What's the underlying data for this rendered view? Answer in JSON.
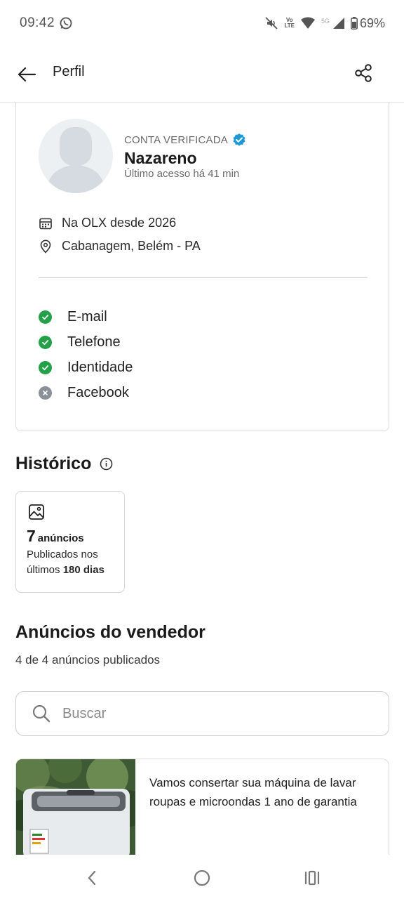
{
  "status_bar": {
    "time": "09:42",
    "battery": "69%",
    "network_badge": "5G",
    "volte_top": "Vo",
    "volte_bottom": "LTE"
  },
  "app_bar": {
    "title": "Perfil"
  },
  "profile": {
    "verified_label": "CONTA VERIFICADA",
    "name": "Nazareno",
    "last_access": "Último acesso há 41 min",
    "member_since": "Na OLX desde 2026",
    "location": "Cabanagem, Belém - PA",
    "verifications": [
      {
        "label": "E-mail",
        "verified": true
      },
      {
        "label": "Telefone",
        "verified": true
      },
      {
        "label": "Identidade",
        "verified": true
      },
      {
        "label": "Facebook",
        "verified": false
      }
    ]
  },
  "history": {
    "title": "Histórico",
    "count": "7",
    "count_unit": "anúncios",
    "desc_prefix": "Publicados nos últimos ",
    "desc_days": "180 dias"
  },
  "seller_ads": {
    "title": "Anúncios do vendedor",
    "count_text": "4 de 4 anúncios publicados",
    "search_placeholder": "Buscar",
    "items": [
      {
        "title": "Vamos consertar sua máquina de lavar roupas e microondas 1 ano de garantia"
      }
    ]
  },
  "colors": {
    "verified_ok": "#24a148",
    "verified_no": "#8a8f98",
    "verified_badge": "#1c9ad6"
  }
}
